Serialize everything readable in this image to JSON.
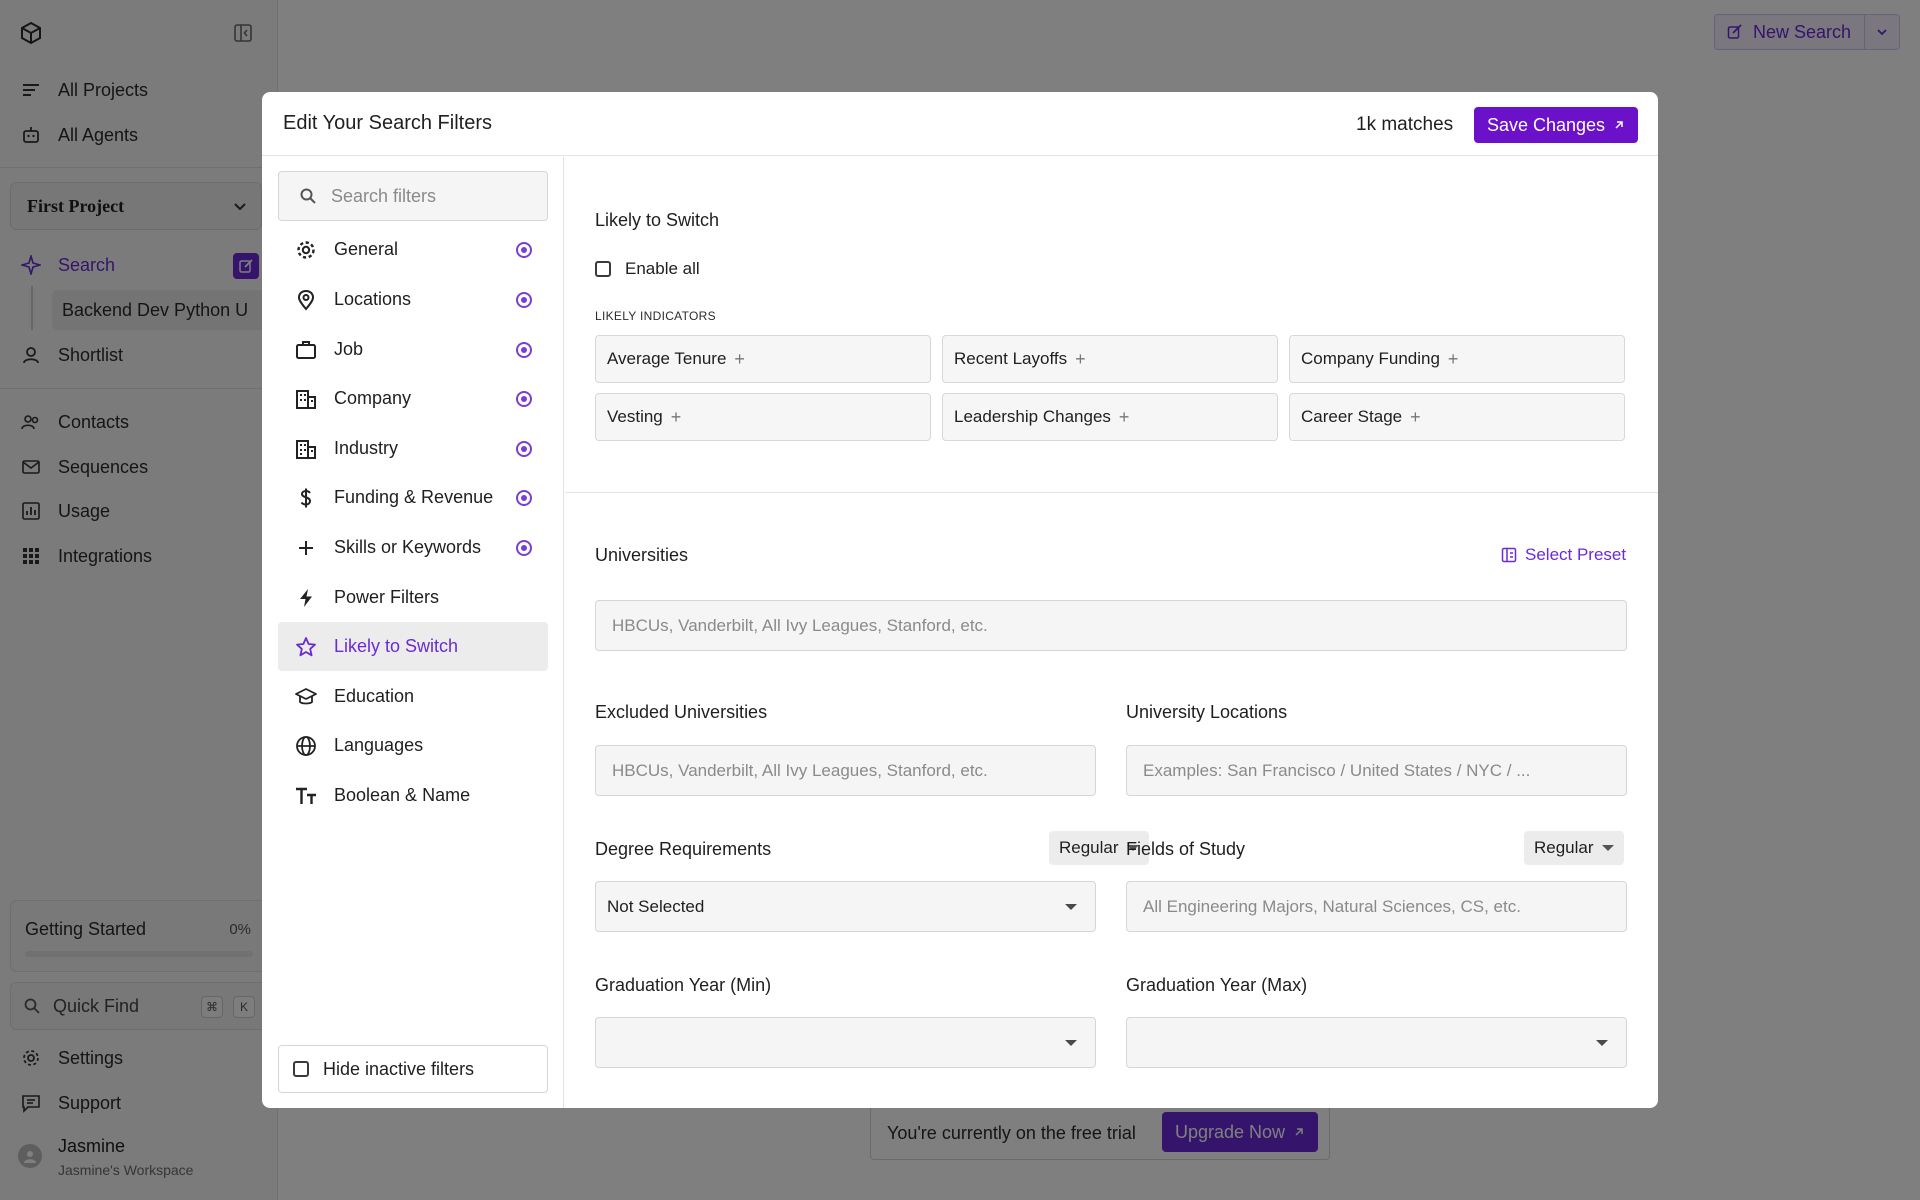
{
  "sidebar": {
    "nav_top": [
      {
        "label": "All Projects",
        "icon": "lines-icon"
      },
      {
        "label": "All Agents",
        "icon": "robot-icon"
      }
    ],
    "project": "First Project",
    "search_label": "Search",
    "search_child": "Backend Dev Python U",
    "shortlist_label": "Shortlist",
    "nav_mid": [
      {
        "label": "Contacts",
        "icon": "people-icon"
      },
      {
        "label": "Sequences",
        "icon": "mail-icon"
      },
      {
        "label": "Usage",
        "icon": "chart-icon"
      },
      {
        "label": "Integrations",
        "icon": "grid-icon"
      }
    ],
    "getting_started": {
      "label": "Getting Started",
      "percent": "0%",
      "progress": 0
    },
    "quick_find": {
      "label": "Quick Find",
      "key1": "⌘",
      "key2": "K"
    },
    "settings_label": "Settings",
    "support_label": "Support",
    "user": {
      "name": "Jasmine",
      "workspace": "Jasmine's Workspace"
    }
  },
  "header": {
    "new_search_label": "New Search"
  },
  "trial_banner": {
    "text": "You're currently on the free trial",
    "upgrade_label": "Upgrade Now"
  },
  "modal": {
    "title": "Edit Your Search Filters",
    "matches": "1k matches",
    "save_label": "Save Changes",
    "search_placeholder": "Search filters",
    "categories": [
      {
        "label": "General",
        "icon": "gear-icon",
        "active_dot": true
      },
      {
        "label": "Locations",
        "icon": "map-pin-icon",
        "active_dot": true
      },
      {
        "label": "Job",
        "icon": "briefcase-icon",
        "active_dot": true
      },
      {
        "label": "Company",
        "icon": "building-icon",
        "active_dot": true
      },
      {
        "label": "Industry",
        "icon": "industry-icon",
        "active_dot": true
      },
      {
        "label": "Funding & Revenue",
        "icon": "dollar-icon",
        "active_dot": true
      },
      {
        "label": "Skills or Keywords",
        "icon": "plus-icon",
        "active_dot": true
      },
      {
        "label": "Power Filters",
        "icon": "bolt-icon",
        "active_dot": false
      },
      {
        "label": "Likely to Switch",
        "icon": "star-icon",
        "active_dot": false,
        "selected": true
      },
      {
        "label": "Education",
        "icon": "graduation-cap-icon",
        "active_dot": false
      },
      {
        "label": "Languages",
        "icon": "globe-icon",
        "active_dot": false
      },
      {
        "label": "Boolean & Name",
        "icon": "text-size-icon",
        "active_dot": false
      }
    ],
    "hide_inactive_label": "Hide inactive filters",
    "likely": {
      "title": "Likely to Switch",
      "enable_all": "Enable all",
      "indicators_label": "LIKELY INDICATORS",
      "indicators": [
        "Average Tenure",
        "Recent Layoffs",
        "Company Funding",
        "Vesting",
        "Leadership Changes",
        "Career Stage"
      ],
      "plus": "+"
    },
    "education": {
      "universities_label": "Universities",
      "select_preset": "Select Preset",
      "universities_placeholder": "HBCUs, Vanderbilt, All Ivy Leagues, Stanford, etc.",
      "excluded_label": "Excluded Universities",
      "excluded_placeholder": "HBCUs, Vanderbilt, All Ivy Leagues, Stanford, etc.",
      "locations_label": "University Locations",
      "locations_placeholder": "Examples: San Francisco / United States / NYC / ...",
      "degree_label": "Degree Requirements",
      "degree_mode": "Regular",
      "degree_value": "Not Selected",
      "fields_label": "Fields of Study",
      "fields_mode": "Regular",
      "fields_placeholder": "All Engineering Majors, Natural Sciences, CS, etc.",
      "grad_min_label": "Graduation Year (Min)",
      "grad_max_label": "Graduation Year (Max)"
    }
  },
  "colors": {
    "accent": "#6b2bd6",
    "save_button": "#6b11c9",
    "overlay": "rgba(0,0,0,0.5)"
  }
}
